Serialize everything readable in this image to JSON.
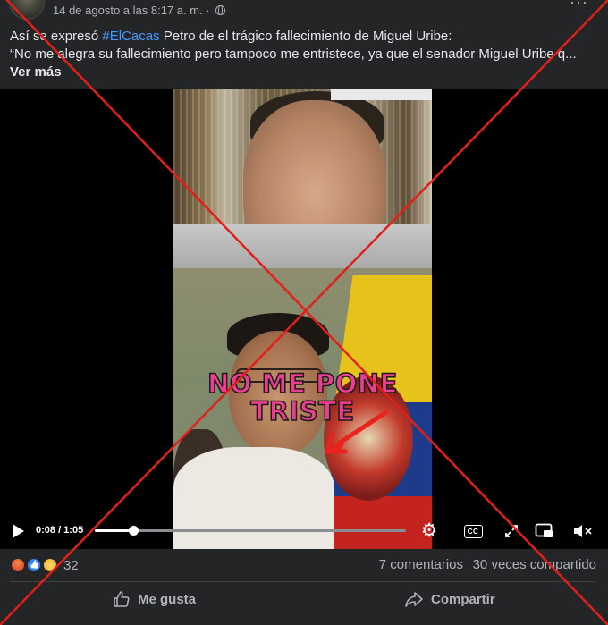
{
  "post": {
    "timestamp": "14 de agosto a las 8:17 a. m.",
    "separator": "·",
    "privacy_icon": "globe-icon",
    "more_options": "···",
    "text_prefix": "Así se expresó ",
    "hashtag": "#ElCacas",
    "text_suffix": " Petro de el trágico fallecimiento de Miguel Uribe:",
    "text_line2": " “No me alegra su fallecimiento pero tampoco me entristece, ya que el senador Miguel Uribe q...",
    "see_more": "Ver más"
  },
  "video": {
    "overlay_line1": "NO ME PONE",
    "overlay_line2": "TRISTE",
    "current_time": "0:08",
    "duration": "1:05",
    "time_display": "0:08 / 1:05",
    "progress_fraction": 0.123,
    "cc_label": "CC",
    "controls": [
      "play-icon",
      "gear-icon",
      "cc-icon",
      "expand-icon",
      "pip-icon",
      "mute-icon"
    ]
  },
  "stats": {
    "reactions": [
      "angry",
      "like",
      "wow"
    ],
    "reaction_count": "32",
    "comments": "7 comentarios",
    "shares": "30 veces compartido"
  },
  "actions": {
    "like_label": "Me gusta",
    "share_label": "Compartir"
  },
  "colors": {
    "background": "#242526",
    "hashtag": "#4599ff",
    "muted_text": "#b0b3b8",
    "cross": "#e0201a"
  }
}
